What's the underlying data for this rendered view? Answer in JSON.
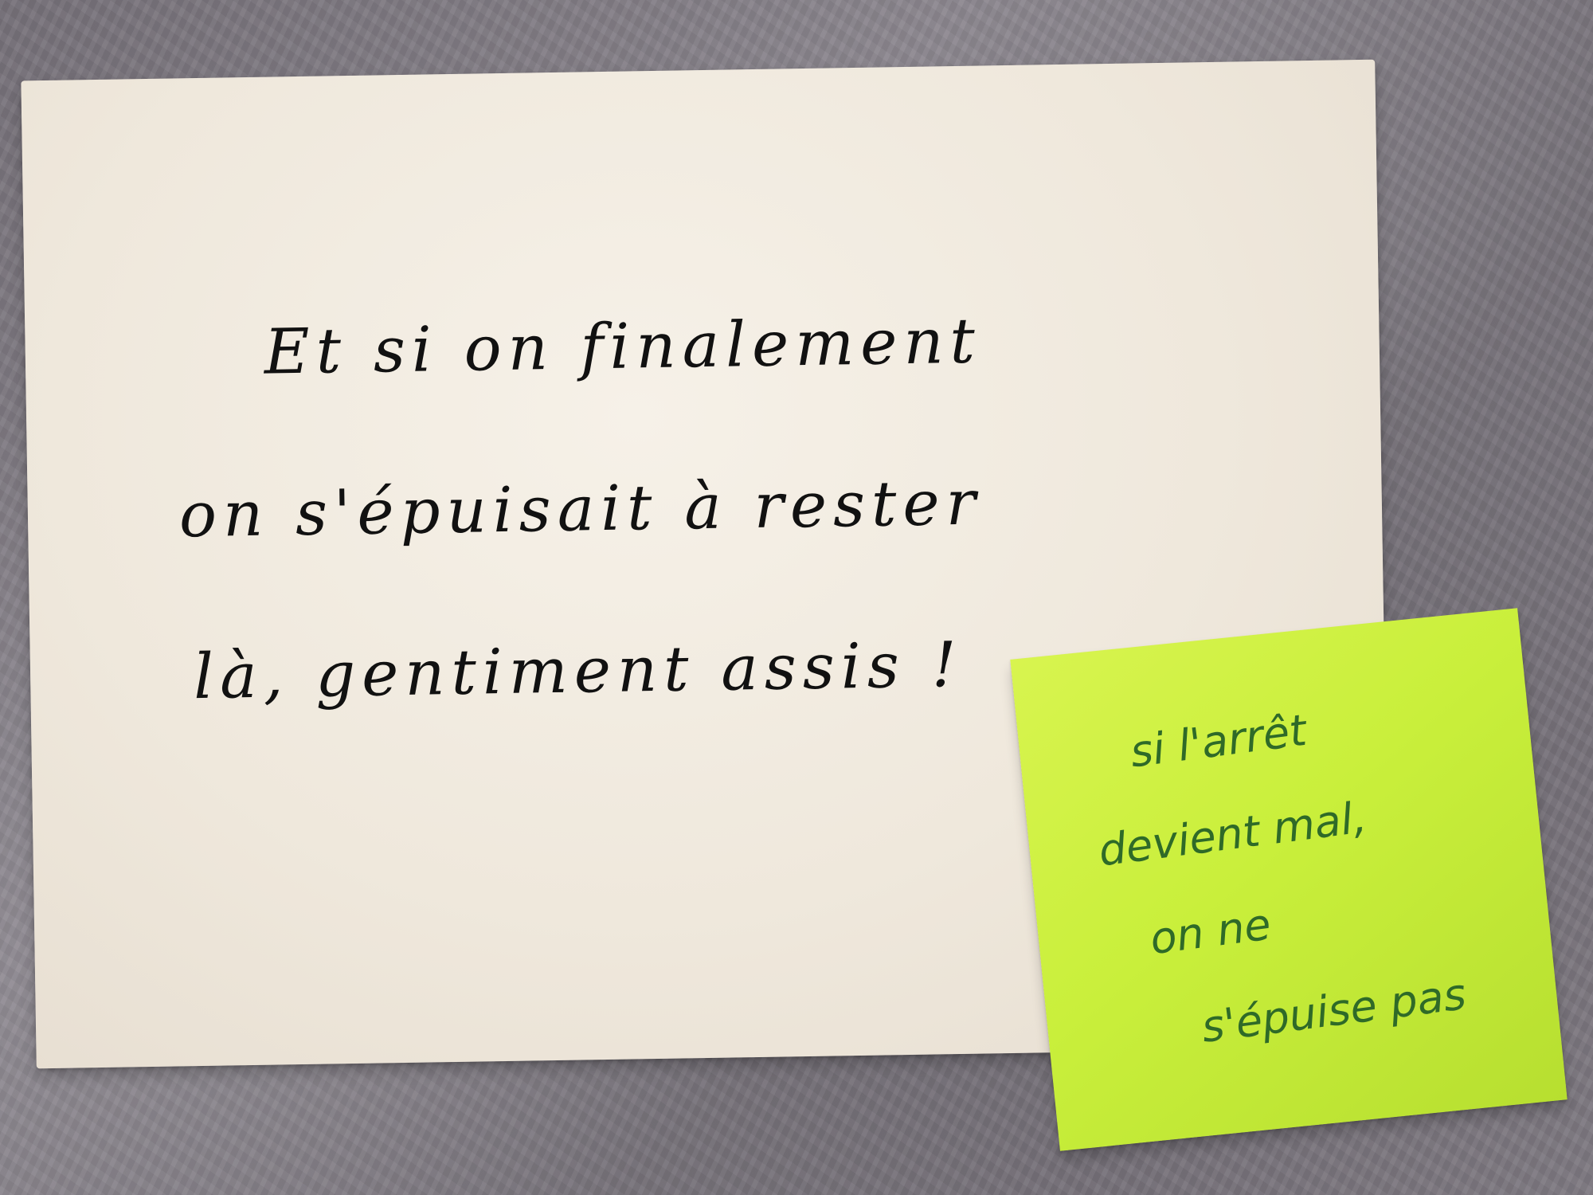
{
  "card": {
    "lines": [
      "Et si on finalement",
      "on s'épuisait à rester",
      "là, gentiment assis !"
    ]
  },
  "sticky_note": {
    "lines": [
      "si l'arrêt",
      "devient mal,",
      "on ne",
      "s'épuise pas"
    ]
  },
  "colors": {
    "card": "#efe8dc",
    "sticky": "#c9ef3b",
    "card_ink": "#111111",
    "sticky_ink": "#2f6a28",
    "background": "#7d7880"
  }
}
